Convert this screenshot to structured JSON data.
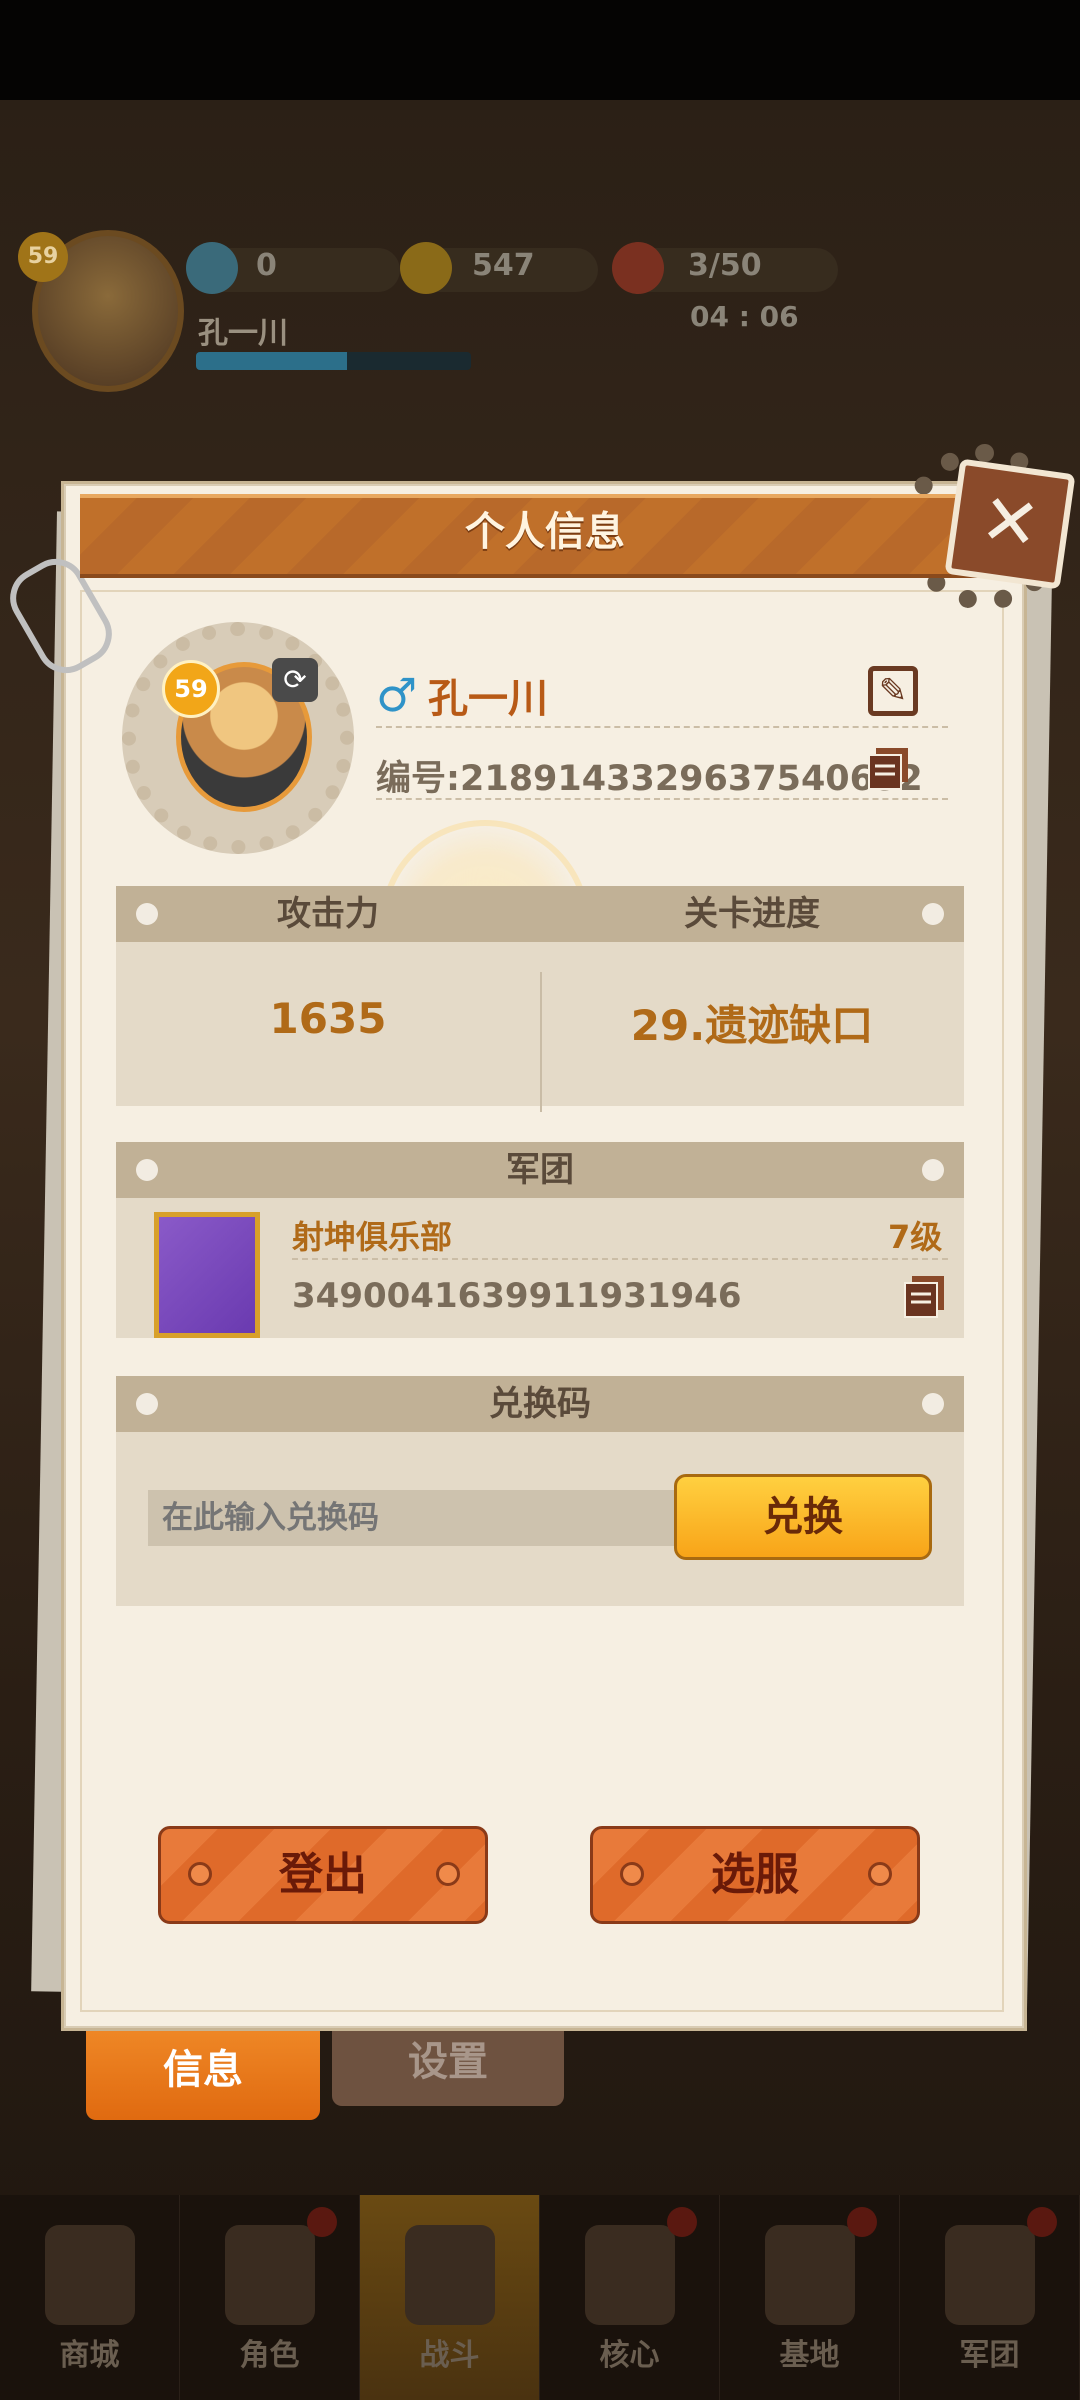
{
  "hud": {
    "level": "59",
    "player_name": "孔一川",
    "gems": "0",
    "coins": "547",
    "stamina": "3/50",
    "stamina_timer": "04 : 06",
    "exp_progress": 0.55
  },
  "dialog": {
    "title": "个人信息",
    "close_icon": "close-icon",
    "profile": {
      "level": "59",
      "gender_symbol": "♂",
      "name": "孔一川",
      "id_text": "编号:2189143329637540652"
    },
    "stats": {
      "attack_label": "攻击力",
      "attack_value": "1635",
      "progress_label": "关卡进度",
      "progress_value": "29.遗迹缺口"
    },
    "guild": {
      "header": "军团",
      "name": "射坤俱乐部",
      "level": "7级",
      "id": "3490041639911931946"
    },
    "redeem": {
      "header": "兑换码",
      "placeholder": "在此输入兑换码",
      "button_label": "兑换"
    },
    "buttons": {
      "logout": "登出",
      "select_server": "选服"
    }
  },
  "tabs": {
    "info": "信息",
    "settings": "设置"
  },
  "bottom_nav": [
    {
      "label": "商城"
    },
    {
      "label": "角色"
    },
    {
      "label": "战斗"
    },
    {
      "label": "核心"
    },
    {
      "label": "基地"
    },
    {
      "label": "军团"
    }
  ],
  "colors": {
    "accent_orange": "#e06a10",
    "name_orange": "#b85a16",
    "gender_blue": "#2f93c8",
    "redeem_yellow": "#f8a418"
  }
}
